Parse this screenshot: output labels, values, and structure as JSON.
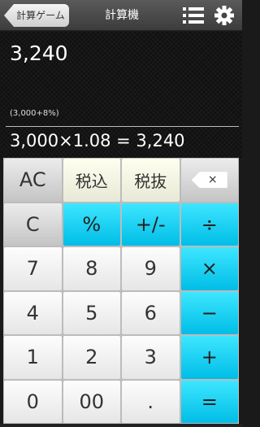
{
  "header": {
    "back_label": "計算ゲーム",
    "title": "計算機"
  },
  "display": {
    "result": "3,240",
    "expression_note": "(3,000+8%)",
    "formula": "3,000×1.08 = 3,240"
  },
  "keys": {
    "ac": "AC",
    "tax_in": "税込",
    "tax_out": "税抜",
    "backspace": "×",
    "clear": "C",
    "percent": "%",
    "plus_minus": "+/-",
    "divide": "÷",
    "seven": "7",
    "eight": "8",
    "nine": "9",
    "multiply": "×",
    "four": "4",
    "five": "5",
    "six": "6",
    "minus": "−",
    "one": "1",
    "two": "2",
    "three": "3",
    "plus": "+",
    "zero": "0",
    "double_zero": "00",
    "decimal": ".",
    "equals": "="
  },
  "colors": {
    "accent": "#19d4f5",
    "header": "#4a4a4a",
    "display_bg": "#111111"
  },
  "icons": [
    "menu-list-icon",
    "gear-icon",
    "backspace-icon"
  ]
}
